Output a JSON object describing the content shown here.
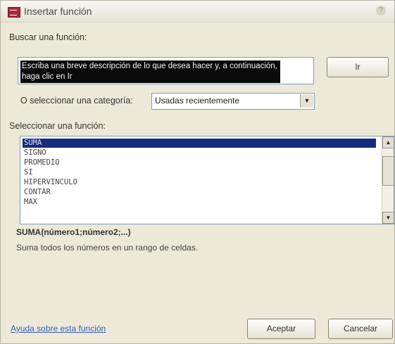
{
  "window": {
    "title": "Insertar función",
    "help_glyph": "?"
  },
  "search": {
    "label": "Buscar una función:",
    "value": "Escriba una breve descripción de lo que desea hacer y, a continuación, haga clic en Ir",
    "go_label": "Ir"
  },
  "category": {
    "label": "O seleccionar una categoría:",
    "selected": "Usadas recientemente"
  },
  "functions": {
    "label": "Seleccionar una función:",
    "items": [
      "SUMA",
      "SIGNO",
      "PROMEDIO",
      "SI",
      "HIPERVINCULO",
      "CONTAR",
      "MAX"
    ],
    "selected_index": 0
  },
  "details": {
    "signature": "SUMA(número1;número2;...)",
    "description": "Suma todos los números en un rango de celdas."
  },
  "footer": {
    "help_link": "Ayuda sobre esta función",
    "ok_label": "Aceptar",
    "cancel_label": "Cancelar"
  },
  "icons": {
    "app": "function-dialog-icon",
    "help": "help-icon",
    "dropdown": "chevron-down-icon",
    "scroll_up": "scroll-up-icon",
    "scroll_down": "scroll-down-icon"
  },
  "colors": {
    "selection_bg": "#182a7a",
    "link": "#3a5fb4"
  }
}
